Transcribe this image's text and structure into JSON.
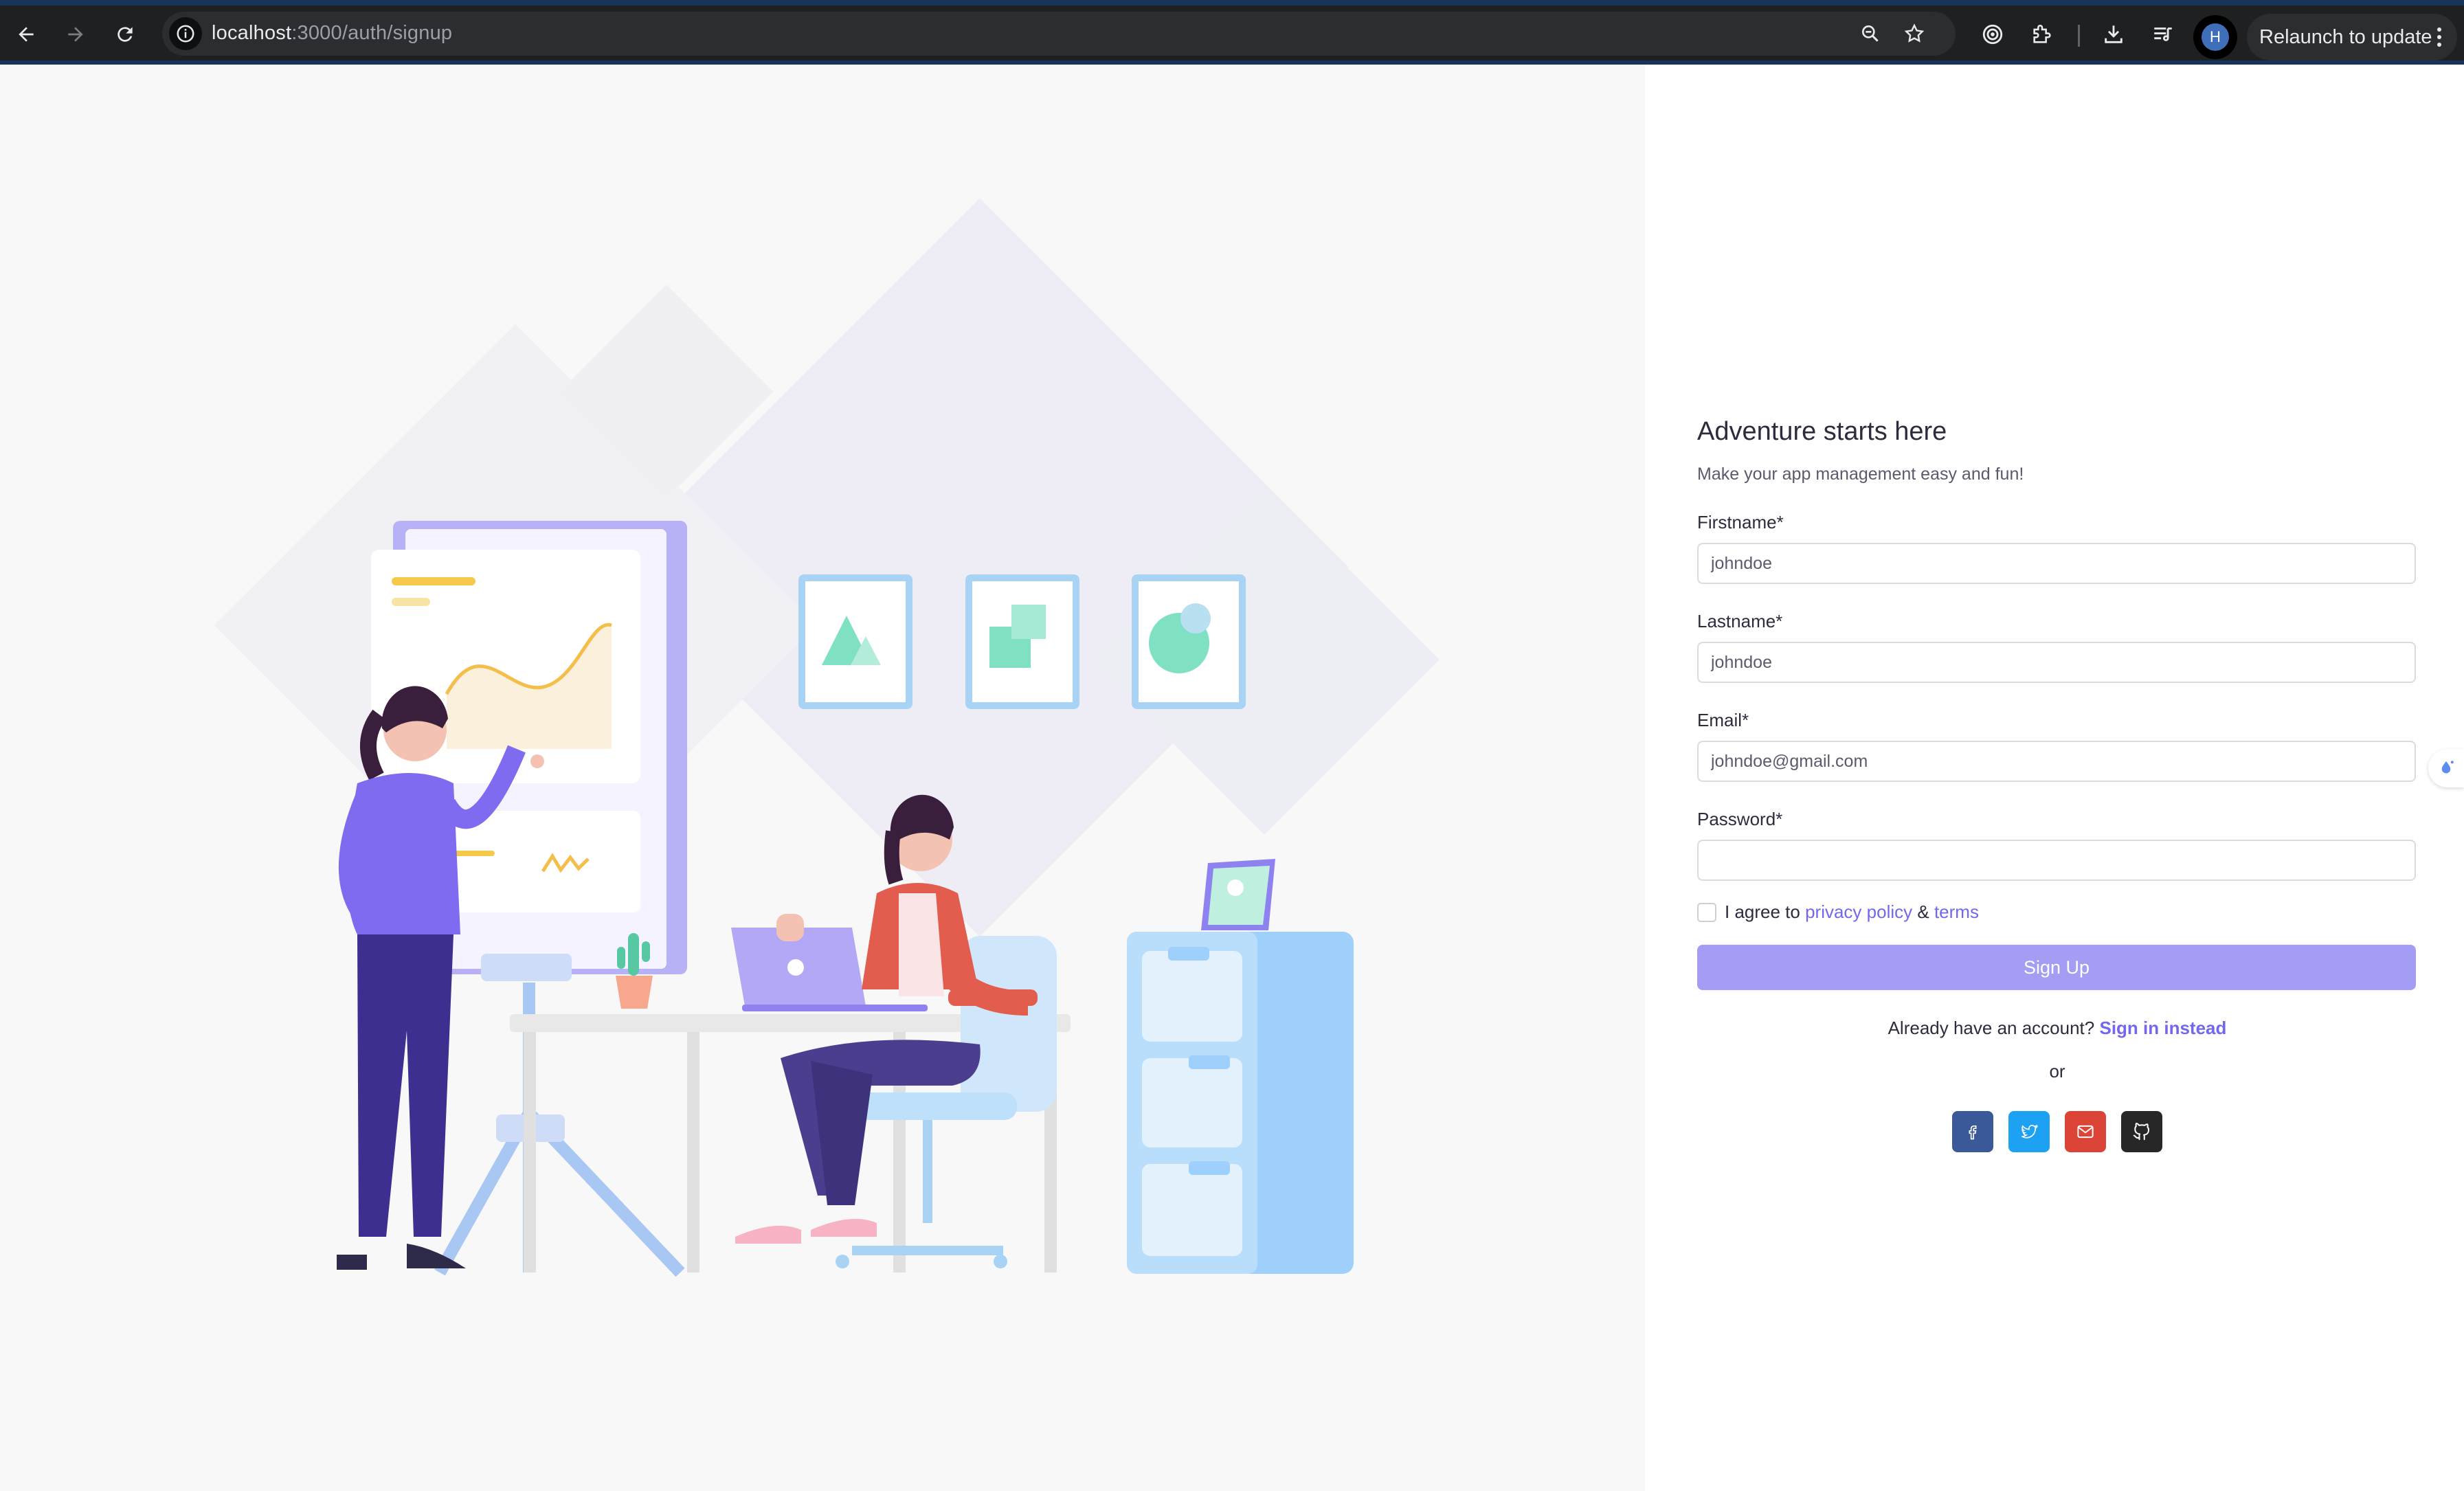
{
  "browser": {
    "url_host": "localhost",
    "url_path": ":3000/auth/signup",
    "profile_initial": "H",
    "relaunch_label": "Relaunch to update"
  },
  "form": {
    "title": "Adventure starts here",
    "subtitle": "Make your app management easy and fun!",
    "firstname_label": "Firstname*",
    "firstname_placeholder": "johndoe",
    "lastname_label": "Lastname*",
    "lastname_placeholder": "johndoe",
    "email_label": "Email*",
    "email_placeholder": "johndoe@gmail.com",
    "password_label": "Password*",
    "password_value": "",
    "agree_prefix": "I agree to ",
    "privacy_link": "privacy policy",
    "amp": " & ",
    "terms_link": "terms",
    "signup_label": "Sign Up",
    "already_text": "Already have an account?",
    "signin_link": "Sign in instead",
    "or_text": "or"
  },
  "socials": [
    {
      "name": "facebook",
      "color": "#3b5998"
    },
    {
      "name": "twitter",
      "color": "#1da1f2"
    },
    {
      "name": "google-mail",
      "color": "#db4437"
    },
    {
      "name": "github",
      "color": "#272727"
    }
  ],
  "colors": {
    "primary": "#7367f0",
    "primary_disabled": "#a59cf3"
  }
}
